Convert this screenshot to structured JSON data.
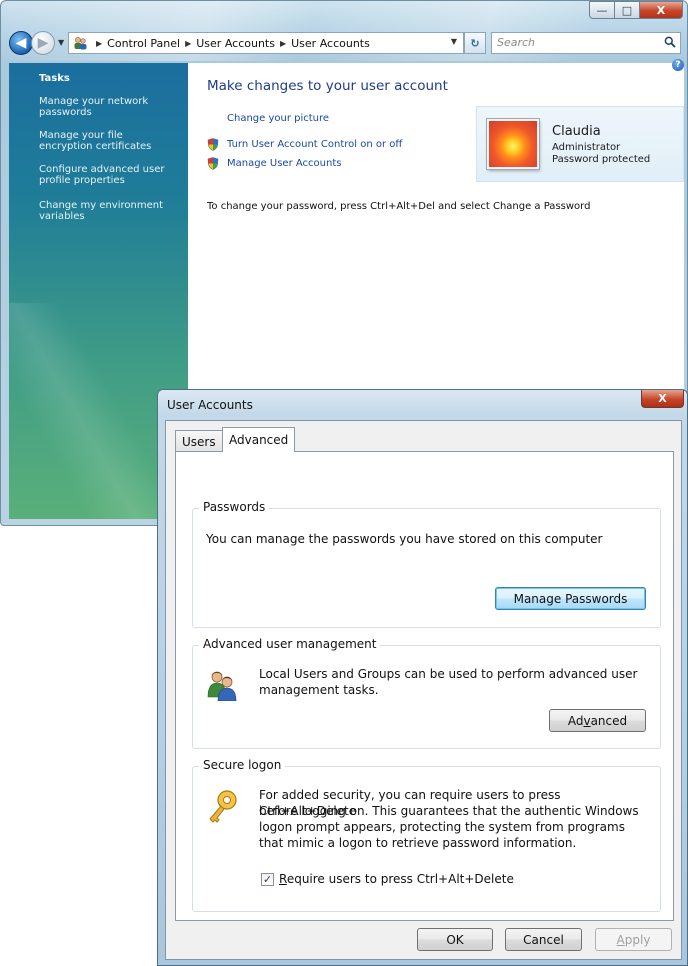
{
  "control_panel": {
    "caption_buttons": [
      "—",
      "□",
      "X"
    ],
    "breadcrumb": [
      "Control Panel",
      "User Accounts",
      "User Accounts"
    ],
    "search_placeholder": "Search",
    "tasks": {
      "title": "Tasks",
      "items": [
        "Manage your network passwords",
        "Manage your file encryption certificates",
        "Configure advanced user profile properties",
        "Change my environment variables"
      ]
    },
    "heading": "Make changes to your user account",
    "links": {
      "change_picture": "Change your picture",
      "turn_uac": "Turn User Account Control on or off",
      "manage_accounts": "Manage User Accounts"
    },
    "account": {
      "name": "Claudia",
      "role": "Administrator",
      "password_status": "Password protected"
    },
    "password_hint": "To change your password, press Ctrl+Alt+Del and select Change a Password"
  },
  "dialog": {
    "title": "User Accounts",
    "close_label": "X",
    "tabs": [
      "Users",
      "Advanced"
    ],
    "active_tab": "Advanced",
    "passwords": {
      "title": "Passwords",
      "text": "You can manage the passwords you have stored on this computer",
      "button": "Manage Passwords"
    },
    "advanced_management": {
      "title": "Advanced user management",
      "text_line1": "Local Users and Groups can be used to perform advanced user",
      "text_line2": "management tasks.",
      "button_pre": "Ad",
      "button_mnemonic": "v",
      "button_post": "anced"
    },
    "secure_logon": {
      "title": "Secure logon",
      "text_lines": [
        "For added security, you can require users to press Ctrl+Alt+Delete",
        "before logging on. This guarantees that the authentic Windows",
        "logon prompt appears, protecting the system from programs",
        "that mimic a logon to retrieve password information."
      ],
      "checkbox_checked": true,
      "checkbox_mnemonic": "R",
      "checkbox_label_rest": "equire users to press Ctrl+Alt+Delete"
    },
    "footer": {
      "ok": "OK",
      "cancel": "Cancel",
      "apply_mnemonic": "A",
      "apply_rest": "pply"
    }
  }
}
